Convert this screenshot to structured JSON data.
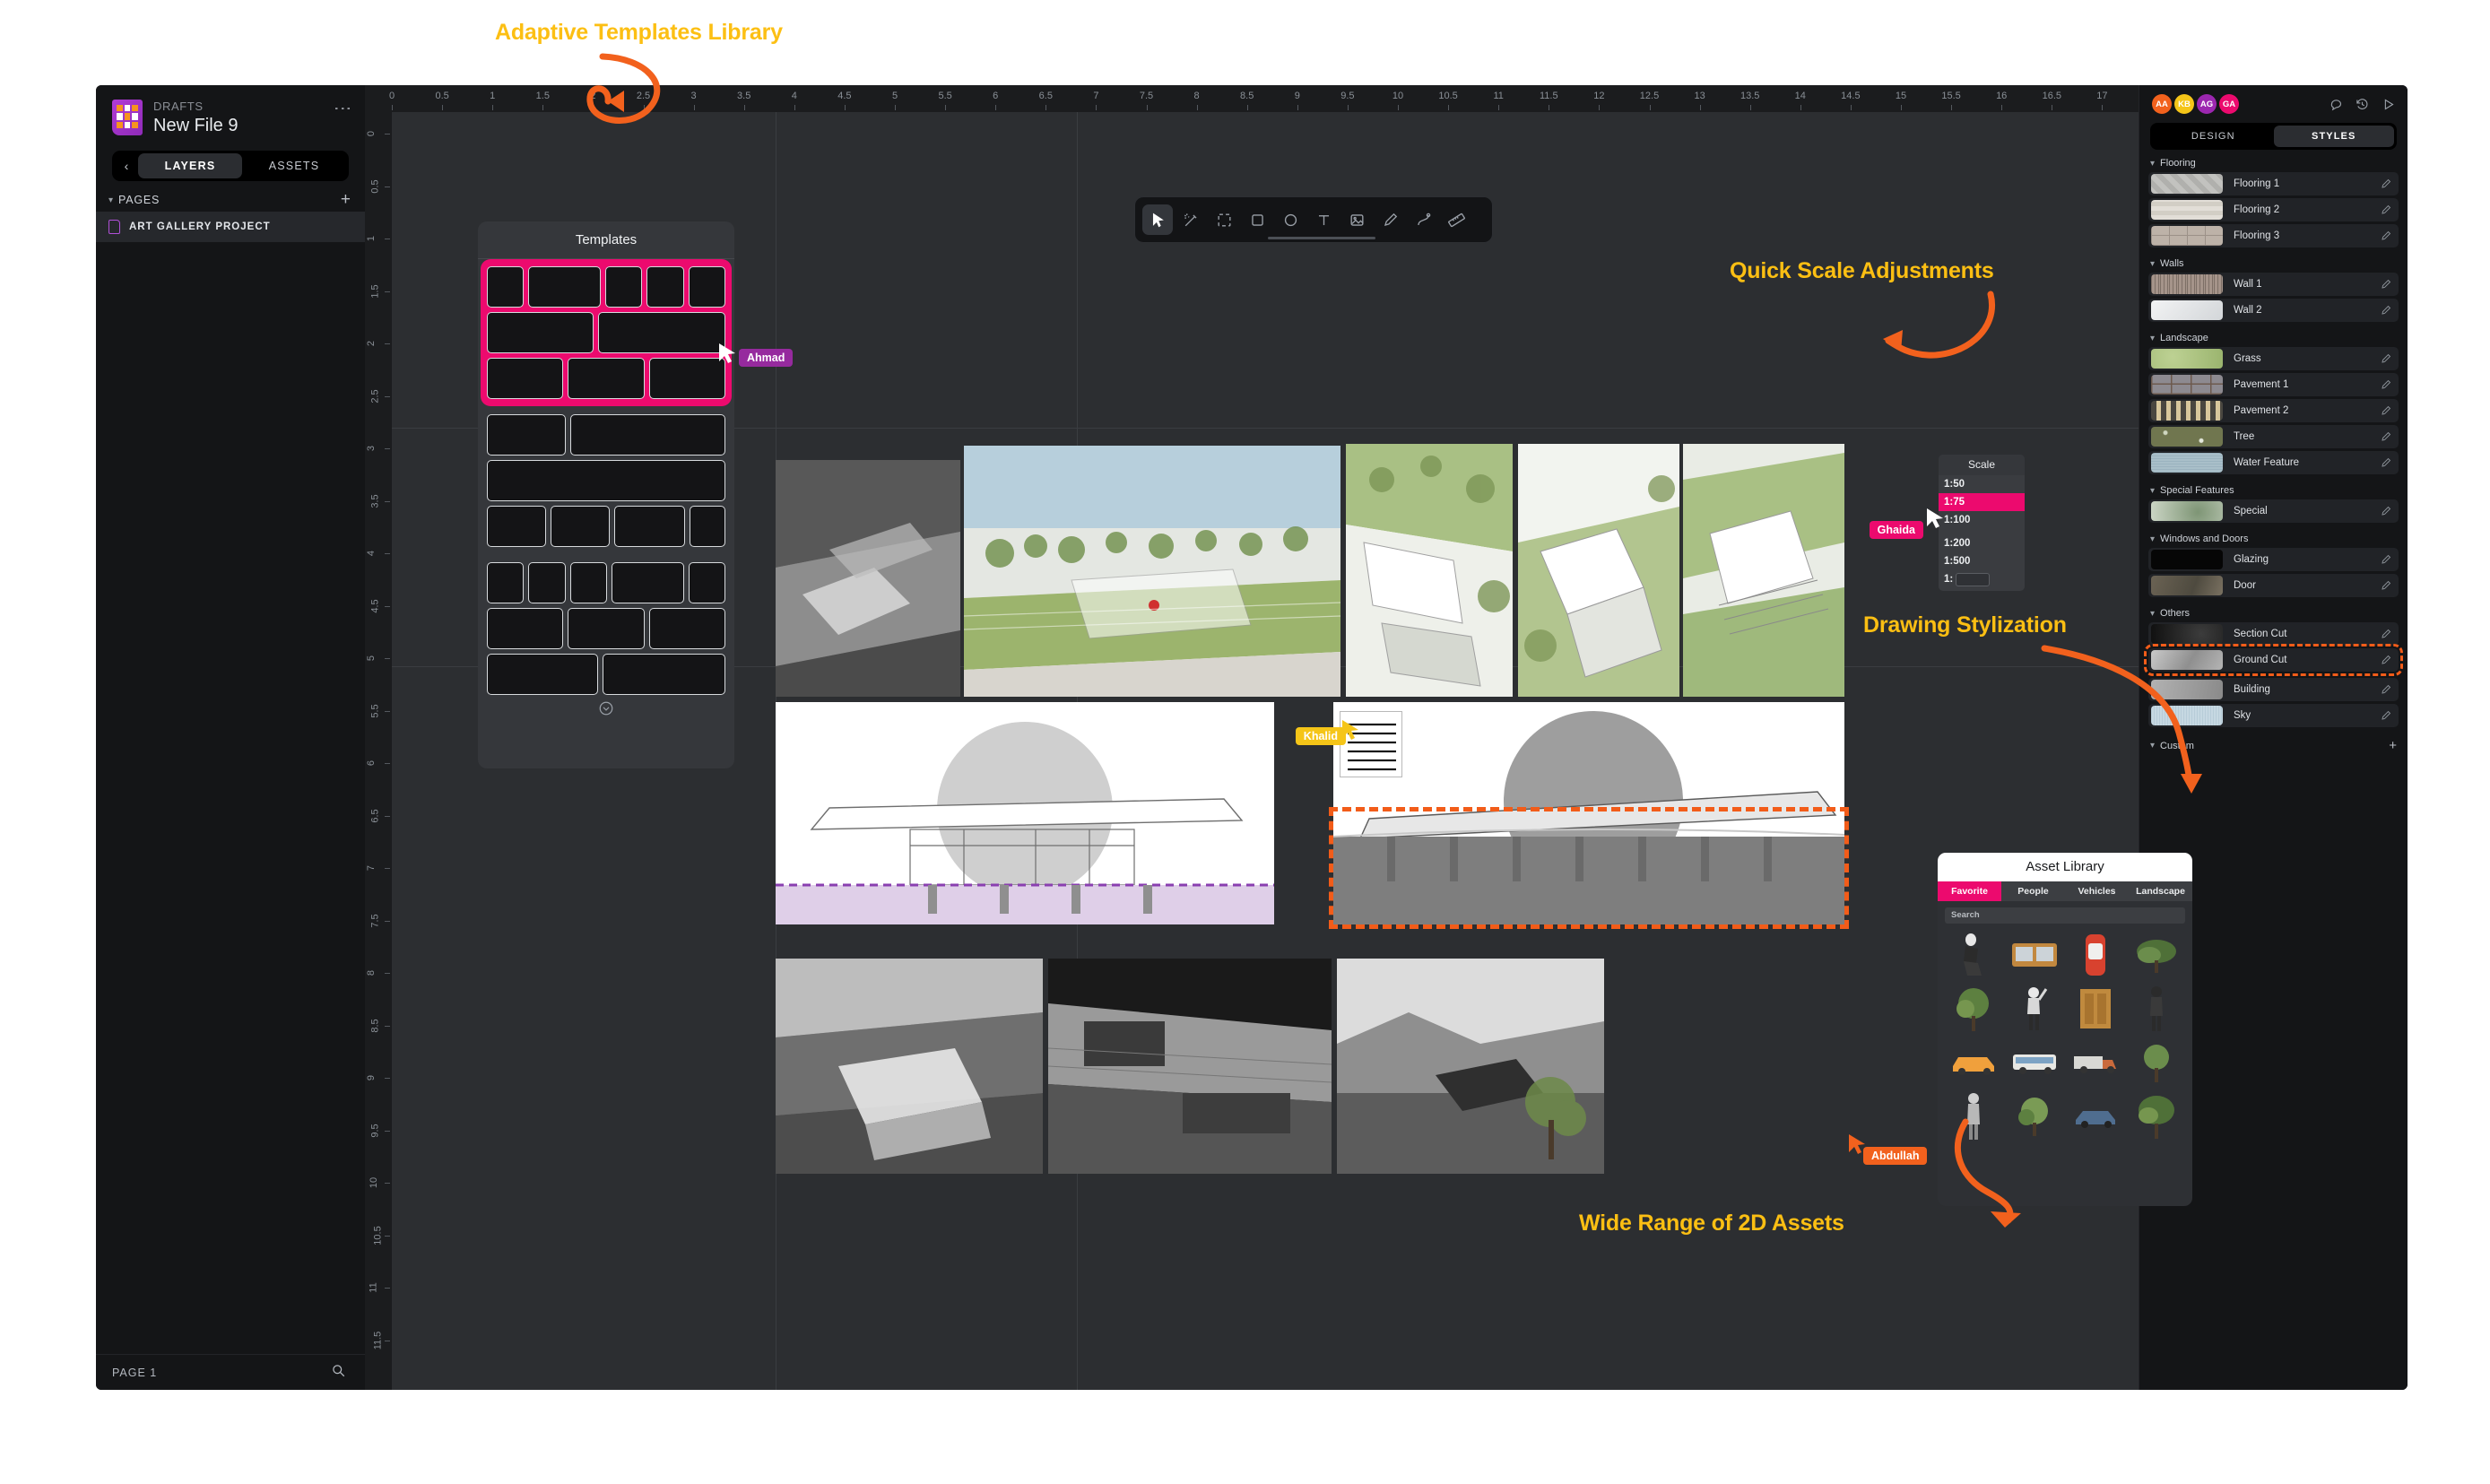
{
  "colors": {
    "accent_pink": "#ec0a6e",
    "annotation_yellow": "#fcbf13",
    "annotation_orange": "#f25c19",
    "panel_dark": "#141517",
    "canvas": "#2c2e31"
  },
  "annotations": [
    {
      "id": "a1",
      "text": "Adaptive Templates Library"
    },
    {
      "id": "a2",
      "text": "Quick Scale Adjustments"
    },
    {
      "id": "a3",
      "text": "Drawing Stylization"
    },
    {
      "id": "a4",
      "text": "Wide Range of 2D Assets"
    }
  ],
  "sidebar": {
    "drafts_label": "DRAFTS",
    "file_name": "New File 9",
    "kebab": "⋮",
    "back_chevron": "‹",
    "tabs": [
      {
        "label": "LAYERS",
        "active": true
      },
      {
        "label": "ASSETS",
        "active": false
      }
    ],
    "pages_section": {
      "label": "PAGES",
      "add": "+"
    },
    "pages": [
      {
        "label": "ART GALLERY PROJECT",
        "selected": true
      }
    ],
    "footer": {
      "page_label": "PAGE 1",
      "search_icon": "search-icon"
    }
  },
  "toolbar": {
    "tools": [
      {
        "name": "cursor-tool",
        "active": true
      },
      {
        "name": "magic-wand-tool",
        "active": false
      },
      {
        "name": "frame-tool",
        "active": false
      },
      {
        "name": "rectangle-tool",
        "active": false
      },
      {
        "name": "ellipse-tool",
        "active": false
      },
      {
        "name": "text-tool",
        "active": false
      },
      {
        "name": "image-tool",
        "active": false
      },
      {
        "name": "pencil-tool",
        "active": false
      },
      {
        "name": "pen-curve-tool",
        "active": false
      },
      {
        "name": "ruler-tool",
        "active": false
      }
    ]
  },
  "rulers": {
    "horizontal_ticks": [
      "0",
      "0.5",
      "1",
      "1.5",
      "2",
      "2.5",
      "3",
      "3.5",
      "4",
      "4.5",
      "5",
      "5.5",
      "6",
      "6.5",
      "7",
      "7.5",
      "8",
      "8.5",
      "9",
      "9.5",
      "10",
      "10.5",
      "11",
      "11.5",
      "12",
      "12.5",
      "13",
      "13.5",
      "14",
      "14.5",
      "15",
      "15.5",
      "16",
      "16.5",
      "17"
    ],
    "vertical_ticks": [
      "0",
      "0.5",
      "1",
      "1.5",
      "2",
      "2.5",
      "3",
      "3.5",
      "4",
      "4.5",
      "5",
      "5.5",
      "6",
      "6.5",
      "7",
      "7.5",
      "8",
      "8.5",
      "9",
      "9.5",
      "10",
      "10.5",
      "11",
      "11.5"
    ]
  },
  "templates_panel": {
    "title": "Templates",
    "expand_icon": "chevron-down-circle-icon",
    "layouts": [
      {
        "selected": true,
        "rows": [
          [
            1,
            2,
            1,
            1,
            1
          ],
          [
            2,
            2
          ],
          [
            1,
            1,
            1
          ]
        ]
      },
      {
        "selected": false,
        "rows": [
          [
            1,
            2
          ],
          [
            1
          ],
          [
            1,
            1,
            1,
            1
          ]
        ]
      },
      {
        "selected": false,
        "rows": [
          [
            1,
            1,
            1,
            2,
            1
          ],
          [
            1,
            1,
            1
          ],
          [
            1,
            1
          ]
        ]
      }
    ]
  },
  "scale_panel": {
    "title": "Scale",
    "options": [
      "1:50",
      "1:75",
      "1:100",
      "1:200",
      "1:500"
    ],
    "selected": "1:75",
    "custom_prefix": "1:",
    "custom_value": ""
  },
  "asset_library": {
    "title": "Asset Library",
    "tabs": [
      {
        "label": "Favorite",
        "active": true
      },
      {
        "label": "People",
        "active": false
      },
      {
        "label": "Vehicles",
        "active": false
      },
      {
        "label": "Landscape",
        "active": false
      }
    ],
    "search_placeholder": "Search",
    "assets": [
      "person-sitting-asset",
      "sofa-asset",
      "red-car-top-asset",
      "tree-pine-asset",
      "tree-green-asset",
      "person-waving-asset",
      "wood-door-asset",
      "person-standing-asset",
      "orange-car-asset",
      "bus-asset",
      "truck-asset",
      "tree-small-asset",
      "person-walking-asset",
      "shrub-asset",
      "blue-car-asset",
      "tree-large-asset"
    ]
  },
  "right_panel": {
    "avatars": [
      {
        "initials": "AA",
        "color": "#f2611d"
      },
      {
        "initials": "KB",
        "color": "#f5c518"
      },
      {
        "initials": "AG",
        "color": "#9c27b0"
      },
      {
        "initials": "GA",
        "color": "#ec0a6e"
      }
    ],
    "icons": [
      "comment-icon",
      "history-icon",
      "play-icon"
    ],
    "tabs": [
      {
        "label": "DESIGN",
        "active": false
      },
      {
        "label": "STYLES",
        "active": true
      }
    ],
    "groups": [
      {
        "name": "Flooring",
        "items": [
          {
            "label": "Flooring 1",
            "swatch": "#b6b6b4",
            "highlight": false
          },
          {
            "label": "Flooring 2",
            "swatch": "#d6d2cb",
            "highlight": false
          },
          {
            "label": "Flooring 3",
            "swatch": "#bdb2a8",
            "highlight": false
          }
        ]
      },
      {
        "name": "Walls",
        "items": [
          {
            "label": "Wall 1",
            "swatch": "#a5948a",
            "highlight": false
          },
          {
            "label": "Wall 2",
            "swatch": "#dfe1e3",
            "highlight": false
          }
        ]
      },
      {
        "name": "Landscape",
        "items": [
          {
            "label": "Grass",
            "swatch": "#a8bf7d",
            "highlight": false
          },
          {
            "label": "Pavement 1",
            "swatch": "#8d8a90",
            "highlight": false
          },
          {
            "label": "Pavement 2",
            "swatch": "#6d6960",
            "highlight": false
          },
          {
            "label": "Tree",
            "swatch": "#70764f",
            "highlight": false
          },
          {
            "label": "Water Feature",
            "swatch": "#a9bfc9",
            "highlight": false
          }
        ]
      },
      {
        "name": "Special Features",
        "items": [
          {
            "label": "Special",
            "swatch": "#b6c2ad",
            "highlight": false
          }
        ]
      },
      {
        "name": "Windows and Doors",
        "items": [
          {
            "label": "Glazing",
            "swatch": "#060606",
            "highlight": false
          },
          {
            "label": "Door",
            "swatch": "#6b6354",
            "highlight": false
          }
        ]
      },
      {
        "name": "Others",
        "items": [
          {
            "label": "Section Cut",
            "swatch": "#2a2a2a",
            "highlight": false
          },
          {
            "label": "Ground Cut",
            "swatch": "#a9a9a9",
            "highlight": true
          },
          {
            "label": "Building",
            "swatch": "#9b9b9b",
            "highlight": false
          },
          {
            "label": "Sky",
            "swatch": "#c6d8e2",
            "highlight": false
          }
        ]
      },
      {
        "name": "Custom",
        "add": "+",
        "items": []
      }
    ]
  },
  "collaborators": [
    {
      "name": "Ahmad",
      "color": "#962a9e"
    },
    {
      "name": "Ghaida",
      "color": "#ec0a6e"
    },
    {
      "name": "Khalid",
      "color": "#f5c518"
    },
    {
      "name": "Abdullah",
      "color": "#f2611d"
    }
  ],
  "corner_widget": {
    "icons": [
      "color-droplet-icon",
      "text-icon"
    ]
  }
}
